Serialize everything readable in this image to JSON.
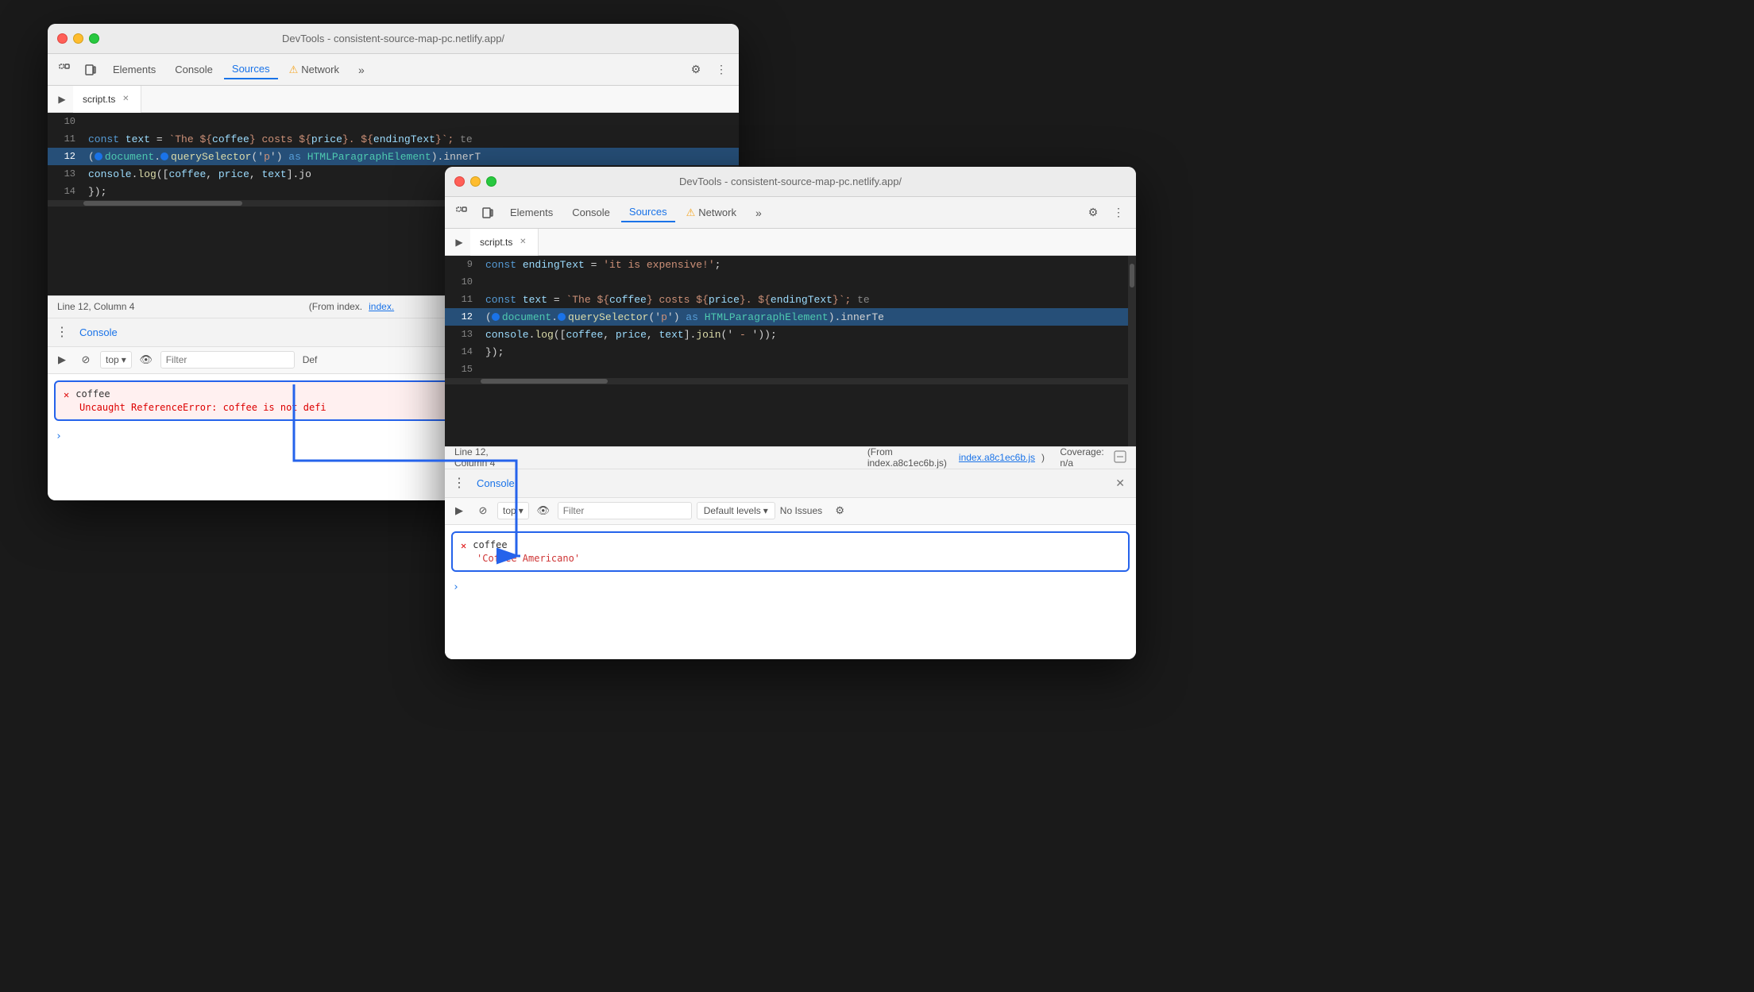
{
  "bg": "#1a1a1a",
  "windows": {
    "back": {
      "title": "DevTools - consistent-source-map-pc.netlify.app/",
      "tabs": [
        "Elements",
        "Console",
        "Sources",
        "Network"
      ],
      "active_tab": "Sources",
      "file_tab": "script.ts",
      "code_lines": [
        {
          "num": 10,
          "content": ""
        },
        {
          "num": 11,
          "content": "  const text = `The ${coffee} costs ${price}. ${endingText}`;  te"
        },
        {
          "num": 12,
          "content": "  (document.querySelector('p') as HTMLParagraphElement).innerT",
          "highlighted": true
        },
        {
          "num": 13,
          "content": "  console.log([coffee, price, text].jo"
        },
        {
          "num": 14,
          "content": "  });"
        }
      ],
      "status_line": "Line 12, Column 4",
      "status_from": "(From index.",
      "console": {
        "label": "Console",
        "filter_placeholder": "Filter",
        "default_label": "Def",
        "top_label": "top",
        "error": {
          "title": "coffee",
          "message": "Uncaught ReferenceError: coffee is not defi"
        }
      }
    },
    "front": {
      "title": "DevTools - consistent-source-map-pc.netlify.app/",
      "tabs": [
        "Elements",
        "Console",
        "Sources",
        "Network"
      ],
      "active_tab": "Sources",
      "file_tab": "script.ts",
      "code_lines": [
        {
          "num": 9,
          "content": "  const endingText = 'it is expensive!';"
        },
        {
          "num": 10,
          "content": ""
        },
        {
          "num": 11,
          "content": "  const text = `The ${coffee} costs ${price}. ${endingText}`;  te"
        },
        {
          "num": 12,
          "content": "  (document.querySelector('p') as HTMLParagraphElement).innerTe",
          "highlighted": true
        },
        {
          "num": 13,
          "content": "  console.log([coffee, price, text].join(' - '));"
        },
        {
          "num": 14,
          "content": "  });"
        },
        {
          "num": 15,
          "content": ""
        }
      ],
      "status_line": "Line 12, Column 4",
      "status_from": "(From index.a8c1ec6b.js)",
      "coverage": "Coverage: n/a",
      "console": {
        "label": "Console",
        "filter_placeholder": "Filter",
        "default_levels": "Default levels",
        "no_issues": "No Issues",
        "top_label": "top",
        "success": {
          "title": "coffee",
          "value": "'Coffee Americano'"
        }
      }
    }
  },
  "arrow": {
    "color": "#2563eb"
  }
}
